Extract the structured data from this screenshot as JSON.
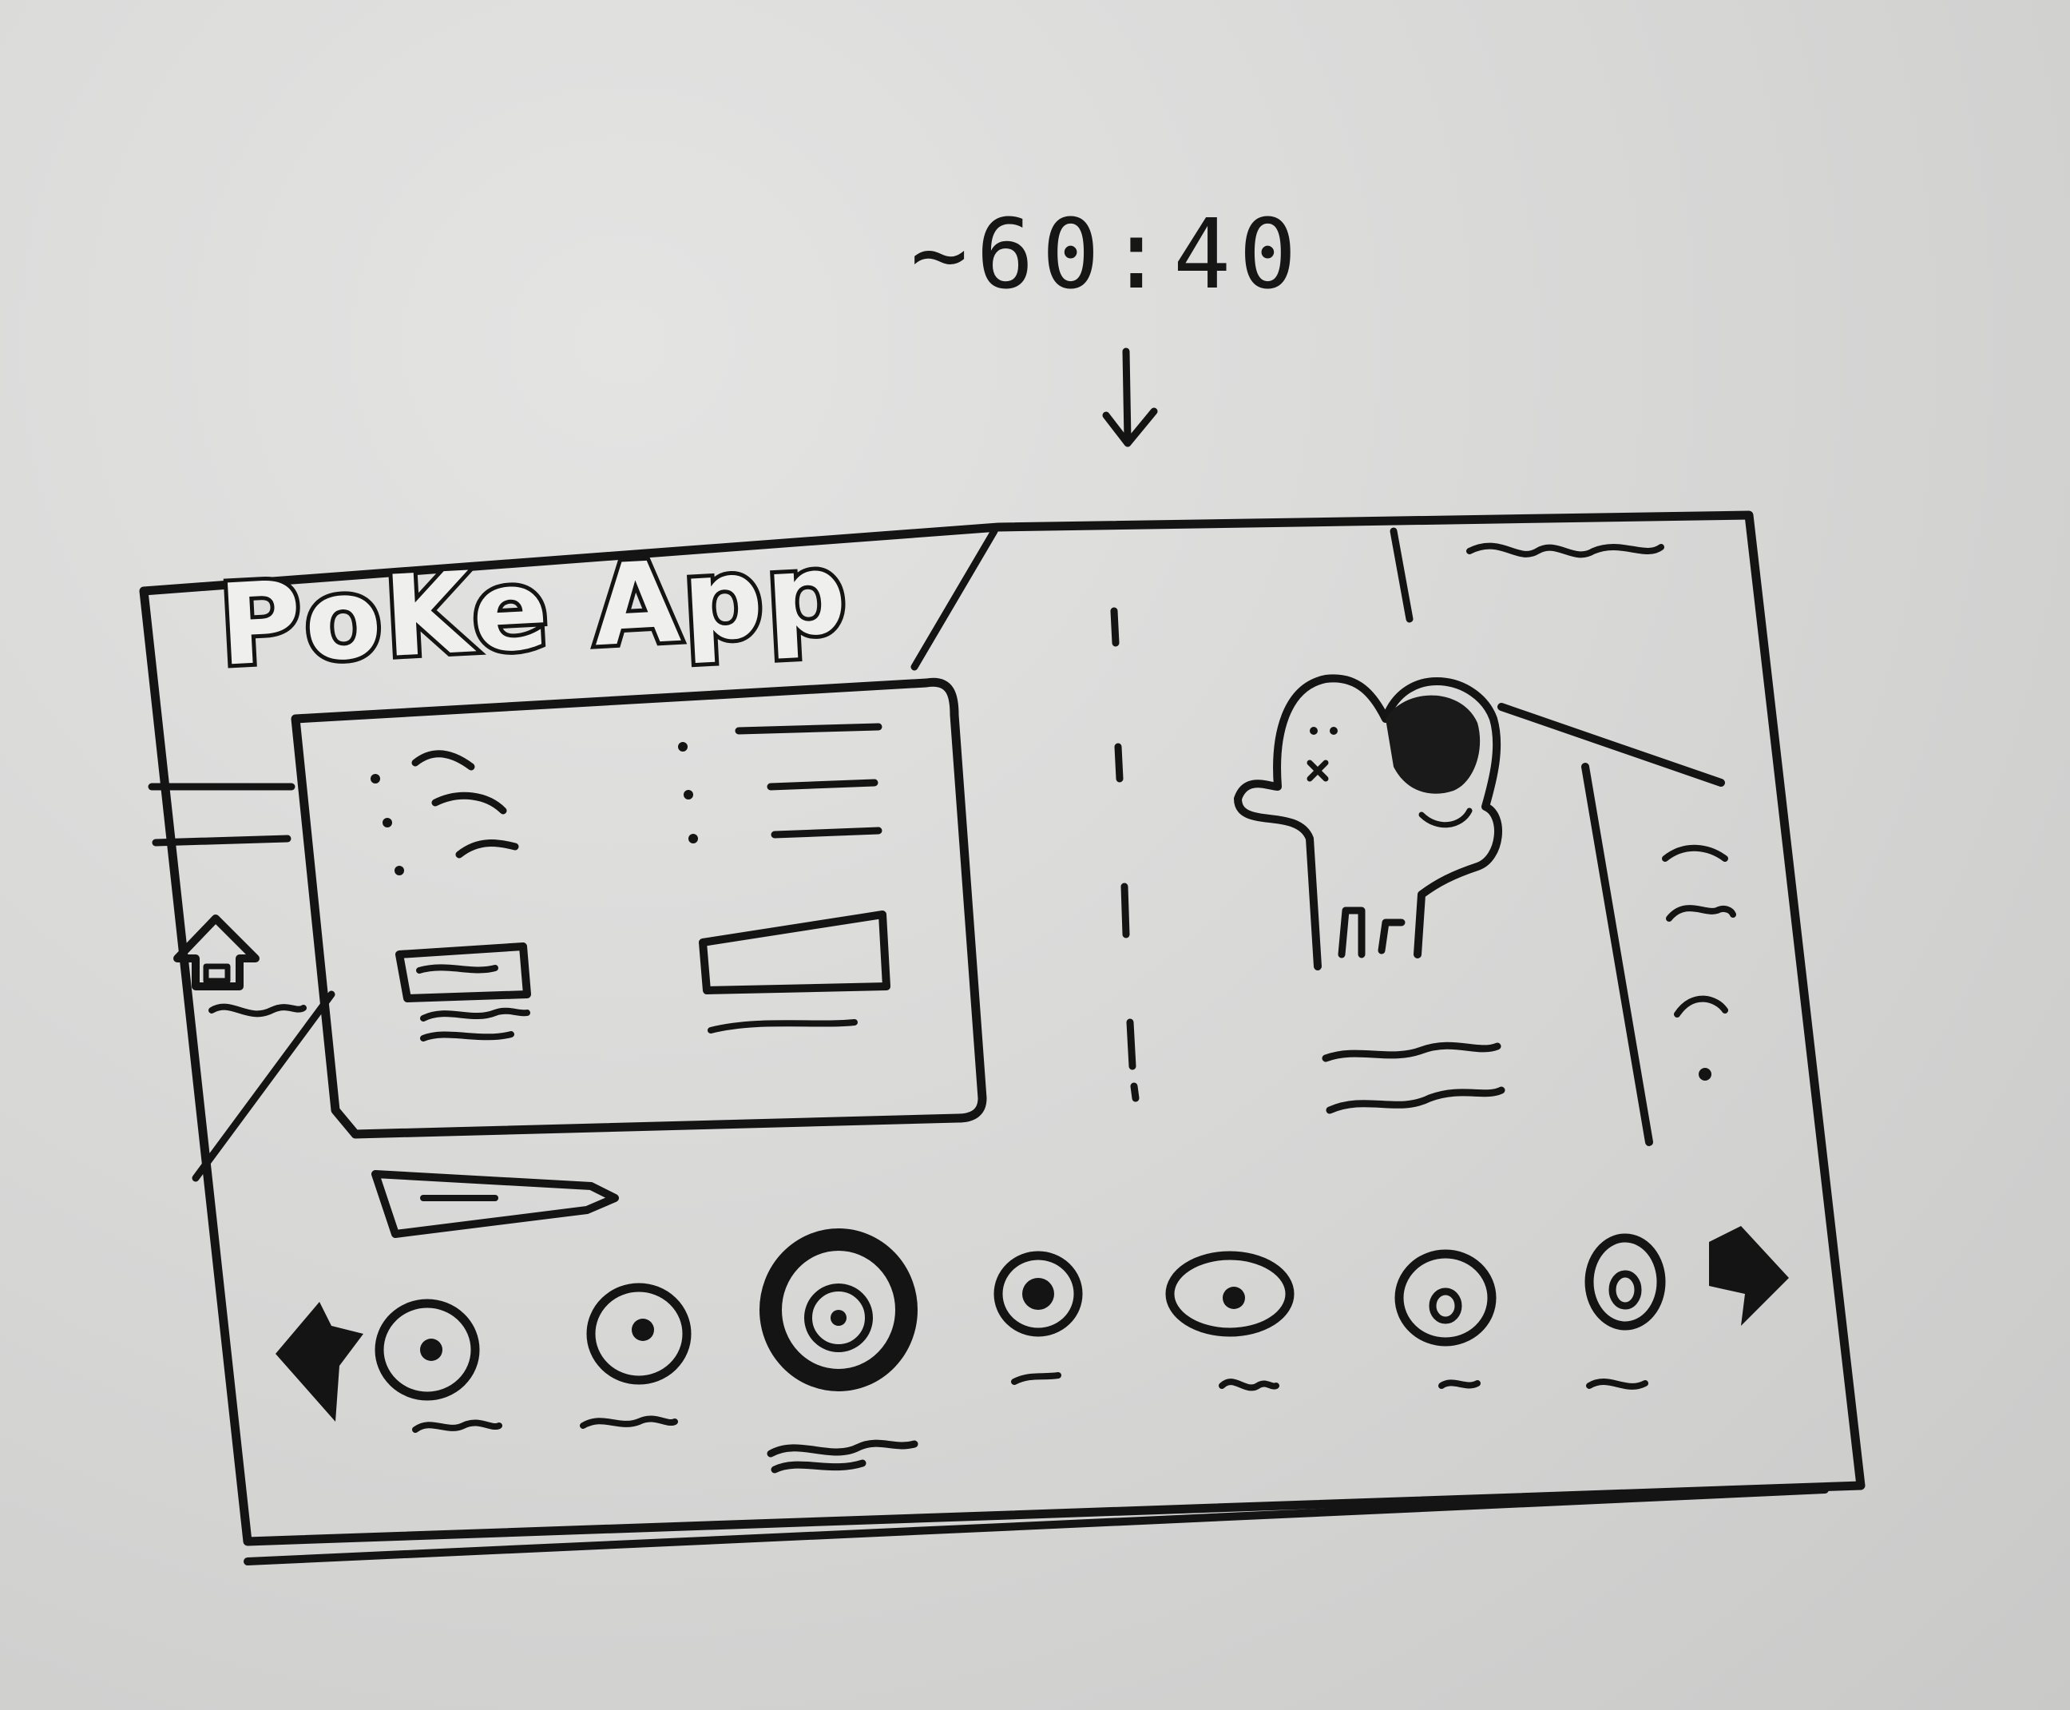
{
  "annotation": {
    "ratio_label": "~60:40"
  },
  "header": {
    "app_title": "PoKe App"
  },
  "sidebar": {
    "items": [
      {
        "icon": "home-icon"
      },
      {
        "icon": "upload-arrow-icon"
      }
    ]
  },
  "info_card": {
    "left_column_icons": [
      "bullet-dot-icon",
      "bullet-dot-icon",
      "bullet-dot-icon"
    ],
    "right_column_icons": [
      "bullet-dot-icon",
      "bullet-dot-icon",
      "bullet-dot-icon"
    ]
  },
  "detail_panel": {
    "avatar_icon": "pokemon-character-icon",
    "stats_list_icons": [
      "stat-line-icon",
      "stat-line-icon",
      "stat-line-icon",
      "stat-line-icon"
    ]
  },
  "carousel": {
    "prev_icon": "left-arrow-icon",
    "next_icon": "right-arrow-icon",
    "items": [
      {
        "icon": "pokemon-thumb-icon"
      },
      {
        "icon": "pokemon-thumb-icon"
      },
      {
        "icon": "pokemon-thumb-icon",
        "selected": true
      },
      {
        "icon": "pokemon-thumb-icon"
      },
      {
        "icon": "pokemon-thumb-icon"
      },
      {
        "icon": "pokemon-thumb-icon"
      },
      {
        "icon": "pokemon-thumb-icon"
      }
    ]
  },
  "colors": {
    "ink": "#141414",
    "paper": "#d8d8d7"
  }
}
